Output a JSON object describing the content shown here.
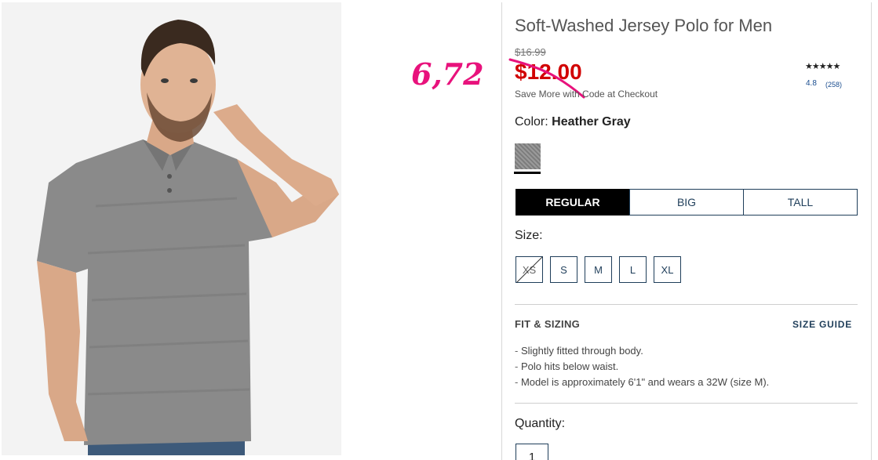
{
  "product": {
    "title": "Soft-Washed Jersey Polo for Men",
    "original_price": "$16.99",
    "sale_price": "$12.00",
    "promo_text": "Save More with Code at Checkout",
    "rating": {
      "stars": "★★★★★",
      "value": "4.8",
      "count": "(258)"
    },
    "color": {
      "label": "Color:",
      "selected": "Heather Gray",
      "swatch_color": "#8e8e8e"
    },
    "fit_tabs": [
      {
        "label": "REGULAR",
        "active": true
      },
      {
        "label": "BIG",
        "active": false
      },
      {
        "label": "TALL",
        "active": false
      }
    ],
    "size": {
      "label": "Size:",
      "options": [
        {
          "label": "XS",
          "available": false
        },
        {
          "label": "S",
          "available": true
        },
        {
          "label": "M",
          "available": true
        },
        {
          "label": "L",
          "available": true
        },
        {
          "label": "XL",
          "available": true
        }
      ]
    },
    "fit_sizing": {
      "heading": "FIT & SIZING",
      "guide_link": "SIZE GUIDE",
      "notes": [
        "Slightly fitted through body.",
        "Polo hits below waist.",
        "Model is approximately 6'1\" and wears a 32W (size M)."
      ]
    },
    "quantity": {
      "label": "Quantity:",
      "value": "1"
    }
  },
  "annotation": {
    "handwritten_price": "6,72",
    "color": "#e8127c"
  },
  "colors": {
    "sale_red": "#d10000",
    "navy": "#1f3e5a",
    "annotation_pink": "#e8127c"
  }
}
